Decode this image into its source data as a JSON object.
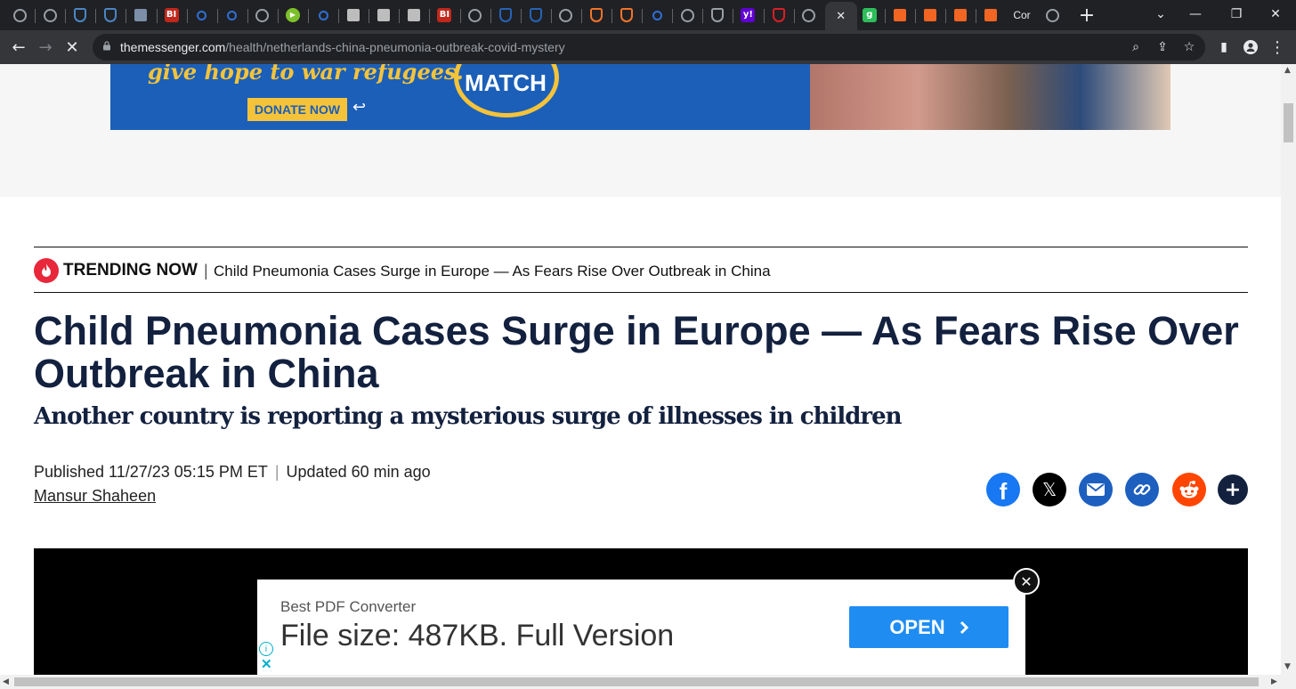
{
  "browser": {
    "tabs": [
      {
        "icon": "globe-icon",
        "color": "#9aa0a6",
        "glyph": ""
      },
      {
        "icon": "globe-icon",
        "color": "#9aa0a6",
        "glyph": ""
      },
      {
        "icon": "shield-icon",
        "color": "#4a86c5",
        "glyph": ""
      },
      {
        "icon": "shield-icon",
        "color": "#4a86c5",
        "glyph": ""
      },
      {
        "icon": "tag-icon",
        "color": "#7c8ea8",
        "glyph": ""
      },
      {
        "icon": "bi-logo-icon",
        "color": "#c1271c",
        "glyph": "BI"
      },
      {
        "icon": "search-icon",
        "color": "#2f6fd6",
        "glyph": ""
      },
      {
        "icon": "search-icon",
        "color": "#2f6fd6",
        "glyph": ""
      },
      {
        "icon": "globe-icon",
        "color": "#9aa0a6",
        "glyph": ""
      },
      {
        "icon": "play-icon",
        "color": "#7cc12a",
        "glyph": ""
      },
      {
        "icon": "search-icon",
        "color": "#2f6fd6",
        "glyph": ""
      },
      {
        "icon": "bookmark-icon",
        "color": "#bdbdbd",
        "glyph": ""
      },
      {
        "icon": "bookmark-icon",
        "color": "#bdbdbd",
        "glyph": ""
      },
      {
        "icon": "bookmark-icon",
        "color": "#bdbdbd",
        "glyph": ""
      },
      {
        "icon": "bi-logo-icon",
        "color": "#c1271c",
        "glyph": "BI"
      },
      {
        "icon": "globe-icon",
        "color": "#9aa0a6",
        "glyph": ""
      },
      {
        "icon": "cube-icon",
        "color": "#2563b8",
        "glyph": ""
      },
      {
        "icon": "cube-icon",
        "color": "#2563b8",
        "glyph": ""
      },
      {
        "icon": "globe-icon",
        "color": "#9aa0a6",
        "glyph": ""
      },
      {
        "icon": "shield-outline-icon",
        "color": "#f2742a",
        "glyph": ""
      },
      {
        "icon": "shield-outline-icon",
        "color": "#f2742a",
        "glyph": ""
      },
      {
        "icon": "search-icon",
        "color": "#2f6fd6",
        "glyph": ""
      },
      {
        "icon": "globe-icon",
        "color": "#9aa0a6",
        "glyph": ""
      },
      {
        "icon": "shield-icon",
        "color": "#9aa0a6",
        "glyph": ""
      },
      {
        "icon": "yahoo-icon",
        "color": "#6001d2",
        "glyph": "y!"
      },
      {
        "icon": "mic-icon",
        "color": "#d81f26",
        "glyph": ""
      },
      {
        "icon": "globe-icon",
        "color": "#9aa0a6",
        "glyph": ""
      },
      {
        "icon": "close-icon",
        "color": "#e8eaed",
        "glyph": "✕",
        "active": true
      },
      {
        "icon": "g-logo-icon",
        "color": "#2dbd5a",
        "glyph": "g"
      },
      {
        "icon": "bookmark-icon",
        "color": "#f26522",
        "glyph": ""
      },
      {
        "icon": "bookmark-icon",
        "color": "#f26522",
        "glyph": ""
      },
      {
        "icon": "bookmark-icon",
        "color": "#f26522",
        "glyph": ""
      },
      {
        "icon": "bookmark-icon",
        "color": "#f26522",
        "glyph": ""
      }
    ],
    "last_tab_label": "Cor",
    "new_tab": "+",
    "url_host": "themessenger.com",
    "url_path": "/health/netherlands-china-pneumonia-outbreak-covid-mystery"
  },
  "ad_banner": {
    "script_text": "give hope to war refugees.",
    "donate_label": "DONATE NOW",
    "match_label": "MATCH"
  },
  "trending": {
    "label": "TRENDING NOW",
    "separator": "|",
    "text": "Child Pneumonia Cases Surge in Europe — As Fears Rise Over Outbreak in China"
  },
  "article": {
    "headline": "Child Pneumonia Cases Surge in Europe — As Fears Rise Over Outbreak in China",
    "subheadline": "Another country is reporting a mysterious surge of illnesses in children",
    "published": "Published 11/27/23 05:15 PM ET",
    "separator": "|",
    "updated": "Updated 60 min ago",
    "author": "Mansur Shaheen"
  },
  "share_buttons": [
    {
      "name": "facebook",
      "color": "#1877f2"
    },
    {
      "name": "x",
      "color": "#000000"
    },
    {
      "name": "email",
      "color": "#1d5fbf"
    },
    {
      "name": "copy-link",
      "color": "#1d5fbf"
    },
    {
      "name": "reddit",
      "color": "#ff4500"
    },
    {
      "name": "more",
      "color": "#13213f"
    }
  ],
  "pdf_ad": {
    "small": "Best PDF Converter",
    "big": "File size: 487KB. Full Version",
    "cta": "OPEN"
  }
}
